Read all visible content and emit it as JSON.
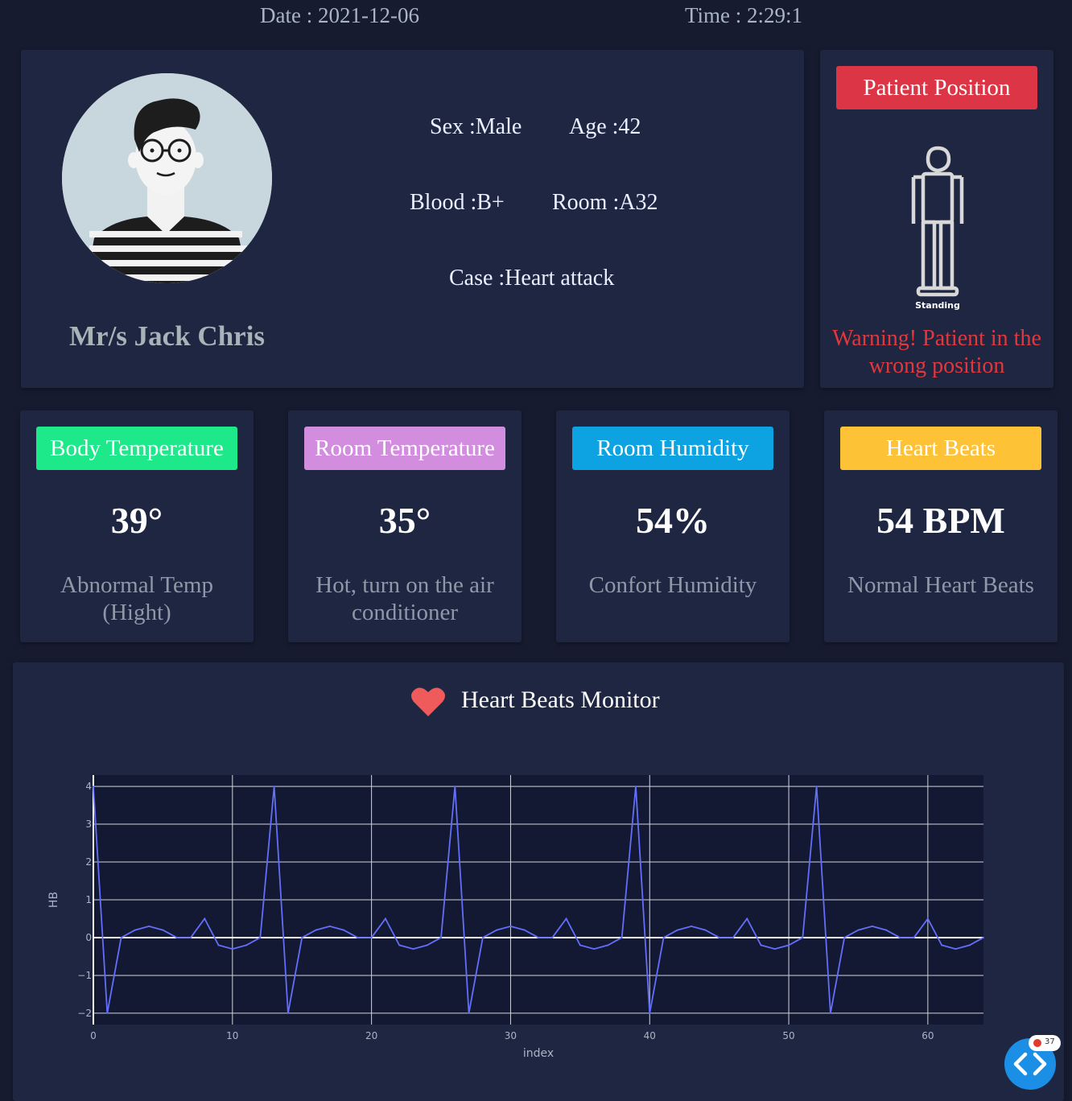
{
  "header": {
    "date": "Date : 2021-12-06",
    "time": "Time : 2:29:1"
  },
  "patient": {
    "name": "Mr/s Jack Chris",
    "sex": "Sex :Male",
    "age": "Age :42",
    "blood": "Blood :B+",
    "room": "Room :A32",
    "case": "Case :Heart attack"
  },
  "position": {
    "title": "Patient Position",
    "figure_label": "Standing",
    "warning": "Warning! Patient in the wrong position",
    "accent": "#dc3545"
  },
  "sensors": [
    {
      "title": "Body Temperature",
      "value": "39°",
      "status": "Abnormal Temp (Hight)",
      "color": "#1de98b"
    },
    {
      "title": "Room Temperature",
      "value": "35°",
      "status": "Hot, turn on the air conditioner",
      "color": "#d28ddf"
    },
    {
      "title": "Room Humidity",
      "value": "54%",
      "status": "Confort Humidity",
      "color": "#0da3e2"
    },
    {
      "title": "Heart Beats",
      "value": "54 BPM",
      "status": "Normal Heart Beats",
      "color": "#fdc235"
    }
  ],
  "monitor": {
    "title": "Heart Beats Monitor"
  },
  "chart_data": {
    "type": "line",
    "xlabel": "index",
    "ylabel": "HB",
    "xlim": [
      0,
      64
    ],
    "ylim": [
      -2.3,
      4.3
    ],
    "xticks": [
      0,
      10,
      20,
      30,
      40,
      50,
      60
    ],
    "yticks": [
      -2,
      -1,
      0,
      1,
      2,
      3,
      4
    ],
    "ytick_labels": [
      "−2",
      "−1",
      "0",
      "1",
      "2",
      "3",
      "4"
    ],
    "grid": true,
    "line_color": "#636efa",
    "x": [
      0,
      1,
      2,
      3,
      4,
      5,
      6,
      7,
      8,
      9,
      10,
      11,
      12,
      13,
      14,
      15,
      16,
      17,
      18,
      19,
      20,
      21,
      22,
      23,
      24,
      25,
      26,
      27,
      28,
      29,
      30,
      31,
      32,
      33,
      34,
      35,
      36,
      37,
      38,
      39,
      40,
      41,
      42,
      43,
      44,
      45,
      46,
      47,
      48,
      49,
      50,
      51,
      52,
      53,
      54,
      55,
      56,
      57,
      58,
      59,
      60,
      61,
      62,
      63,
      64
    ],
    "y": [
      4,
      -2,
      0,
      0.2,
      0.3,
      0.2,
      0,
      0,
      0.5,
      -0.2,
      -0.3,
      -0.2,
      0,
      4,
      -2,
      0,
      0.2,
      0.3,
      0.2,
      0,
      0,
      0.5,
      -0.2,
      -0.3,
      -0.2,
      0,
      4,
      -2,
      0,
      0.2,
      0.3,
      0.2,
      0,
      0,
      0.5,
      -0.2,
      -0.3,
      -0.2,
      0,
      4,
      -2,
      0,
      0.2,
      0.3,
      0.2,
      0,
      0,
      0.5,
      -0.2,
      -0.3,
      -0.2,
      0,
      4,
      -2,
      0,
      0.2,
      0.3,
      0.2,
      0,
      0,
      0.5,
      -0.2,
      -0.3,
      -0.2,
      0
    ]
  },
  "fab": {
    "count": "37"
  }
}
